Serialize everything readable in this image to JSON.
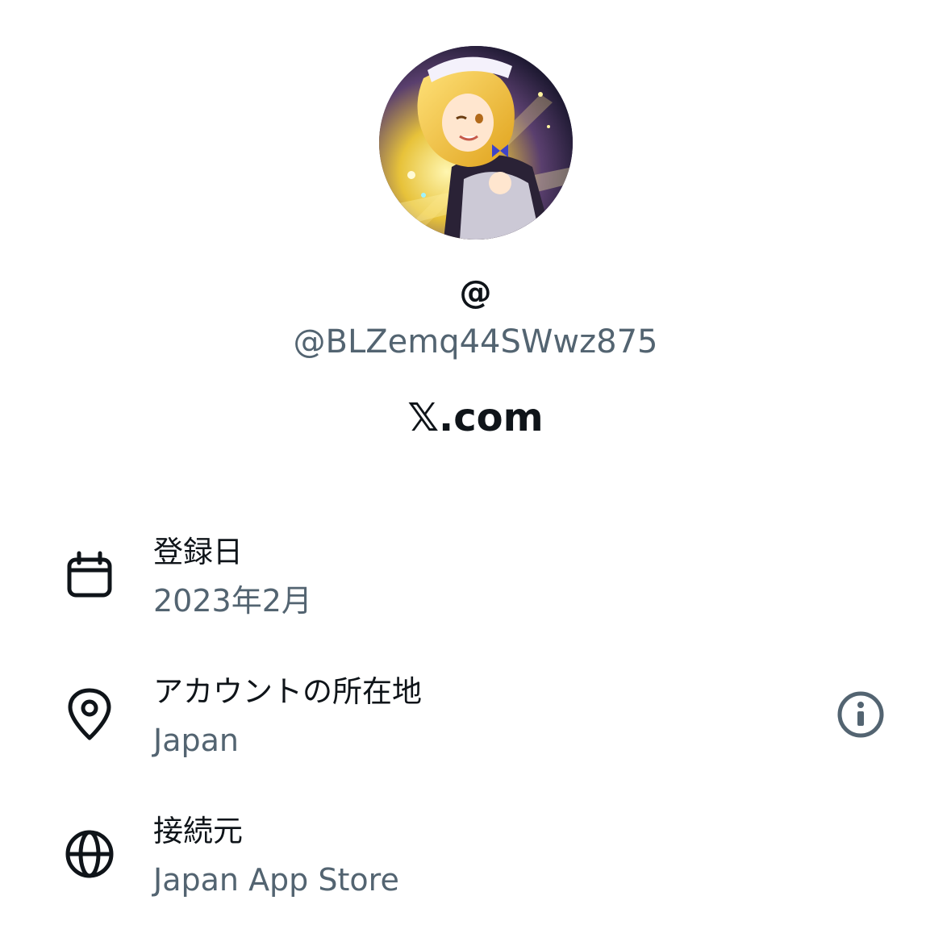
{
  "profile": {
    "display_name": "@",
    "handle": "@BLZemq44SWwz875",
    "brand": "𝕏.com"
  },
  "about": {
    "joined": {
      "icon": "calendar-icon",
      "label": "登録日",
      "value": "2023年2月"
    },
    "location": {
      "icon": "location-pin-icon",
      "label": "アカウントの所在地",
      "value": "Japan",
      "info_icon": "info-icon"
    },
    "connected_via": {
      "icon": "globe-icon",
      "label": "接続元",
      "value": "Japan App Store"
    }
  },
  "colors": {
    "text_primary": "#0f1419",
    "text_secondary": "#536471"
  }
}
